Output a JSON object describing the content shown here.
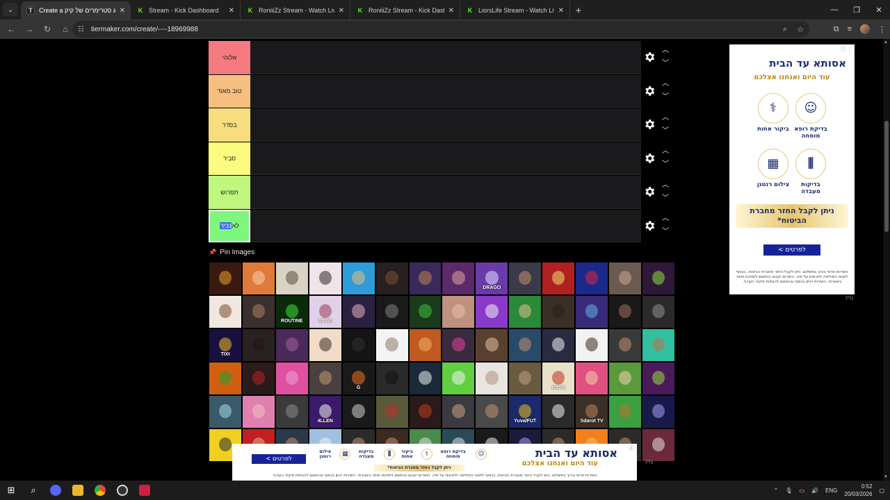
{
  "browser": {
    "tabs": [
      {
        "title": "Create a רשימת דירוג סטרימרים של קיק",
        "favicon": "tiermaker",
        "active": true
      },
      {
        "title": "Stream - Kick Dashboard",
        "favicon": "kick",
        "active": false
      },
      {
        "title": "RoniiiZz Stream - Watch Live on Kick",
        "favicon": "kick",
        "active": false
      },
      {
        "title": "RoniiiZz Stream - Kick Dashboard",
        "favicon": "kick",
        "active": false
      },
      {
        "title": "LiorsLife Stream - Watch Live on Kick",
        "favicon": "kick",
        "active": false
      }
    ],
    "address": "tiermaker.com/create/----18969988"
  },
  "tiers": [
    {
      "label": "אלוהי",
      "color": "#f47a7f",
      "selected": false
    },
    {
      "label": "טוב מאוד",
      "color": "#f6bf7f",
      "selected": false
    },
    {
      "label": "בסדר",
      "color": "#f8dd7f",
      "selected": false
    },
    {
      "label": "סביר",
      "color": "#fbfb7f",
      "selected": false
    },
    {
      "label": "תפרוש",
      "color": "#bff77f",
      "selected": false
    },
    {
      "label_pre": "לא ",
      "label_hl": "נכיר",
      "color": "#7ff77f",
      "selected": true
    }
  ],
  "pin_images_label": "Pin Images",
  "ad_side": {
    "brand": "אסותא עד הבית",
    "subtitle": "עוד היום ואנחנו אצלכם",
    "services": [
      "ביקור אחות",
      "בדיקת רופא מומחה",
      "צילום רנטגן",
      "בדיקות מעבדה"
    ],
    "gold_text": "ניתן לקבל החזר מחברת הביטוח*",
    "cta": "לפרטים >",
    "fine_print": "השירות פרטי וכרוך בתשלום. ניתן לקבל החזר מחברת הביטוח, בכפוף לתנאי הפוליסה ולזכאות על פיה. התורים יקבעו בהתאם לזמינות ואזור גיאוגרפי. השירות יינתן בכפוף ובהתאם להנחיות פיקוד העורף.",
    "tag": "PN"
  },
  "ad_bottom": {
    "brand": "אסותא עד הבית",
    "subtitle": "עוד היום ואנחנו אצלכם",
    "services": [
      "בדיקת רופא מומחה",
      "ביקור אחות",
      "בדיקות מעבדה",
      "צילום רנטגן"
    ],
    "gold_text": "ניתן לקבל החזר מחברת הביטוח*",
    "cta": "לפרטים >",
    "fine_print": "השירות פרטי וכרוך בתשלום. ניתן לקבל החזר מחברת הביטוח, בכפוף לתנאי הפוליסה ולזכאות על פיה. התורים יקבעו בהתאם לזמינות ואזור גיאוגרפי. השירות יינתן בכפוף ובהתאם להנחיות פיקוד העורף.",
    "tag": "PN"
  },
  "image_tiles": [
    {
      "bg": "#3a1a10",
      "fg": "#e8a030"
    },
    {
      "bg": "#e07a3a",
      "fg": "#f5d0a8"
    },
    {
      "bg": "#d9d2c5",
      "fg": "#5a4a3a"
    },
    {
      "bg": "#efe4e8",
      "fg": "#2a2a2a"
    },
    {
      "bg": "#2e9cd8",
      "fg": "#e0c080"
    },
    {
      "bg": "#262020",
      "fg": "#7a5030"
    },
    {
      "bg": "#3a2a5a",
      "fg": "#c08050"
    },
    {
      "bg": "#5a2a6a",
      "fg": "#e0a0a0"
    },
    {
      "bg": "#6a3aa8",
      "fg": "#e0e0ff",
      "text": "DRAGO"
    },
    {
      "bg": "#3a3a4a",
      "fg": "#c09070"
    },
    {
      "bg": "#b02020",
      "fg": "#f0e070"
    },
    {
      "bg": "#1b2a8a",
      "fg": "#e02040"
    },
    {
      "bg": "#6a5a50",
      "fg": "#d0a890"
    },
    {
      "bg": "#301838",
      "fg": "#90e040"
    },
    {
      "bg": "#f0e8e0",
      "fg": "#7a4a2a"
    },
    {
      "bg": "#3a3030",
      "fg": "#b08060"
    },
    {
      "bg": "#0a2a0a",
      "fg": "#40e040",
      "text": "ROUTINE"
    },
    {
      "bg": "#e0d0e8",
      "fg": "#9a3a5a",
      "text": "הנרדף"
    },
    {
      "bg": "#2a2040",
      "fg": "#e0b0c0"
    },
    {
      "bg": "#1a1a1a",
      "fg": "#808080"
    },
    {
      "bg": "#1a3a1a",
      "fg": "#40c040"
    },
    {
      "bg": "#c09080",
      "fg": "#e8c0a0"
    },
    {
      "bg": "#8a3ac8",
      "fg": "#f0f0f0"
    },
    {
      "bg": "#2a8a3a",
      "fg": "#e0c090"
    },
    {
      "bg": "#3a3028",
      "fg": "#2a2018"
    },
    {
      "bg": "#3a2a7a",
      "fg": "#60b0e0"
    },
    {
      "bg": "#1a1818",
      "fg": "#a07060"
    },
    {
      "bg": "#2a2a2a",
      "fg": "#909090"
    },
    {
      "bg": "#1a1040",
      "fg": "#f0c020",
      "text": "TIXI"
    },
    {
      "bg": "#2a2220",
      "fg": "#1a1a1a"
    },
    {
      "bg": "#4a2a5a",
      "fg": "#a060a0"
    },
    {
      "bg": "#f0dcc8",
      "fg": "#3a2a20"
    },
    {
      "bg": "#141414",
      "fg": "#303030"
    },
    {
      "bg": "#f4f4f4",
      "fg": "#8a7a6a"
    },
    {
      "bg": "#c05a20",
      "fg": "#f0b060"
    },
    {
      "bg": "#3a2a40",
      "fg": "#e040a0"
    },
    {
      "bg": "#5a4030",
      "fg": "#e0c0a0"
    },
    {
      "bg": "#2a4a6a",
      "fg": "#c09070"
    },
    {
      "bg": "#2a2a40",
      "fg": "#f0f0f0"
    },
    {
      "bg": "#f2f2f2",
      "fg": "#3a2a20"
    },
    {
      "bg": "#3a3a3a",
      "fg": "#c09070"
    },
    {
      "bg": "#30c0a0",
      "fg": "#c07050"
    },
    {
      "bg": "#d06010",
      "fg": "#20a030"
    },
    {
      "bg": "#2a1a1a",
      "fg": "#c02020"
    },
    {
      "bg": "#e050a0",
      "fg": "#f0a0d0"
    },
    {
      "bg": "#4a4040",
      "fg": "#c09a70"
    },
    {
      "bg": "#1a1a1a",
      "fg": "#f07020",
      "text": "G"
    },
    {
      "bg": "#2a2a2a",
      "fg": "#101010"
    },
    {
      "bg": "#1a2a3a",
      "fg": "#f0f0f0"
    },
    {
      "bg": "#60d040",
      "fg": "#f0f0f0"
    },
    {
      "bg": "#e8e4e0",
      "fg": "#b09080"
    },
    {
      "bg": "#6a5a40",
      "fg": "#c0a080"
    },
    {
      "bg": "#e8e0c8",
      "fg": "#c03020",
      "text": "פינחס"
    },
    {
      "bg": "#e05080",
      "fg": "#f0d0b0"
    },
    {
      "bg": "#5a9a3a",
      "fg": "#f0d0b0"
    },
    {
      "bg": "#4a1a5a",
      "fg": "#90e040"
    },
    {
      "bg": "#3a5a6a",
      "fg": "#a0e0e0"
    },
    {
      "bg": "#e080b0",
      "fg": "#f0c0c0"
    },
    {
      "bg": "#3a3a3a",
      "fg": "#8a8a8a"
    },
    {
      "bg": "#3a1a6a",
      "fg": "#f0f0f0",
      "text": "4LLEN"
    },
    {
      "bg": "#1a1a1a",
      "fg": "#d0d0d0"
    },
    {
      "bg": "#5a5a3a",
      "fg": "#c03030"
    },
    {
      "bg": "#2a1a1a",
      "fg": "#c04020"
    },
    {
      "bg": "#3a3a40",
      "fg": "#d0a080"
    },
    {
      "bg": "#4a4a4a",
      "fg": "#c09070"
    },
    {
      "bg": "#1a2a6a",
      "fg": "#f0c020",
      "text": "YuvalFUT"
    },
    {
      "bg": "#2a2a2a",
      "fg": "#f0f0f0"
    },
    {
      "bg": "#3a3028",
      "fg": "#c08050",
      "text": "Sdarot TV"
    },
    {
      "bg": "#3aa040",
      "fg": "#c07030"
    },
    {
      "bg": "#1a1a4a",
      "fg": "#a0a0f0"
    },
    {
      "bg": "#f0d020",
      "fg": "#2a2a2a"
    },
    {
      "bg": "#c02020",
      "fg": "#e0b090"
    },
    {
      "bg": "#2a3a4a",
      "fg": "#c09070"
    },
    {
      "bg": "#a0c0e0",
      "fg": "#f0f0f0"
    },
    {
      "bg": "#2a2a2a",
      "fg": "#c09070"
    },
    {
      "bg": "#3a2a20",
      "fg": "#c09070"
    },
    {
      "bg": "#4a8a4a",
      "fg": "#e0e0e0"
    },
    {
      "bg": "#2a4a5a",
      "fg": "#e0e0e0"
    },
    {
      "bg": "#1a1a1a",
      "fg": "#f0f0f0"
    },
    {
      "bg": "#1a1a3a",
      "fg": "#a0a0f0"
    },
    {
      "bg": "#2a2a2a",
      "fg": "#c09070"
    },
    {
      "bg": "#f08020",
      "fg": "#f0c060"
    },
    {
      "bg": "#2a2a2a",
      "fg": "#c09070"
    },
    {
      "bg": "#6a2a3a",
      "fg": "#e0e0e0"
    }
  ],
  "taskbar": {
    "lang": "ENG",
    "time": "0:52",
    "date": "20/03/2026"
  }
}
